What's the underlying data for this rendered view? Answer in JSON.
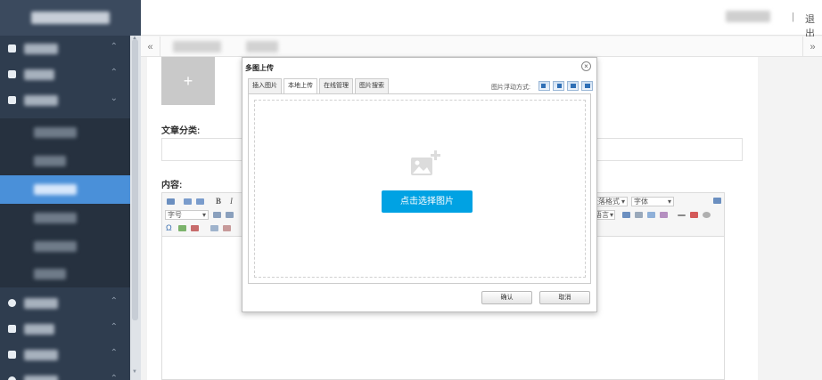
{
  "header": {
    "separator": "|",
    "logout_label": "退出"
  },
  "tabbar": {
    "left_arrow": "«",
    "right_arrow": "»"
  },
  "form": {
    "upload_plus": "+",
    "category_label": "文章分类:",
    "content_label": "内容:"
  },
  "editor_toolbar": {
    "font_size_select": "字号",
    "paragraph_select": "段落格式",
    "font_family_select": "字体",
    "bold": "B",
    "italic": "I",
    "omega": "Ω",
    "partial_text": "语言"
  },
  "modal": {
    "title": "多图上传",
    "close": "×",
    "tabs": [
      {
        "label": "插入图片"
      },
      {
        "label": "本地上传"
      },
      {
        "label": "在线管理"
      },
      {
        "label": "图片搜索"
      }
    ],
    "active_tab": "本地上传",
    "float_label": "图片浮动方式:",
    "select_button": "点击选择图片",
    "confirm_button": "确认",
    "cancel_button": "取消"
  },
  "colors": {
    "sidebar_bg": "#2f3d4f",
    "active_item": "#4a90d9",
    "primary_button": "#00a2e3"
  }
}
